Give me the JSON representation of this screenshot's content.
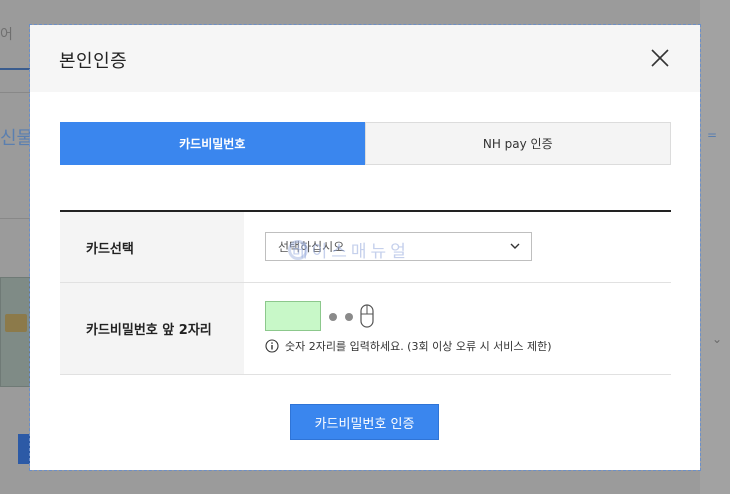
{
  "background": {
    "tab_fragment": "어",
    "blue_fragment": "신물",
    "right_fragment": "=",
    "right_chevron": "⌄"
  },
  "modal": {
    "title": "본인인증",
    "close_icon": "close-icon",
    "tabs": [
      {
        "label": "카드비밀번호",
        "active": true
      },
      {
        "label": "NH pay 인증",
        "active": false
      }
    ],
    "rows": {
      "card_select_label": "카드선택",
      "card_select_value": "선택하십시오",
      "pin_label": "카드비밀번호 앞 2자리",
      "pin_value": "",
      "help_text": "숫자 2자리를 입력하세요. (3회 이상 오류 시 서비스 제한)"
    },
    "watermark": "베이스매뉴얼",
    "submit_label": "카드비밀번호 인증"
  },
  "colors": {
    "accent": "#3a86ee",
    "pin_field": "#c8f8c8",
    "overlay": "#9b9b9b"
  }
}
